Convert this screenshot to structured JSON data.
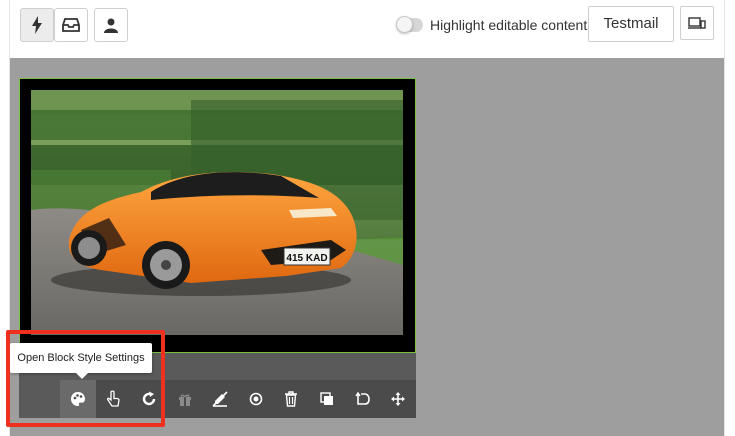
{
  "toolbar": {
    "buttons": [
      {
        "name": "lightning-icon",
        "active": true
      },
      {
        "name": "inbox-icon",
        "active": false
      },
      {
        "name": "user-icon",
        "active": false
      }
    ],
    "highlight_toggle_label": "Highlight editable content",
    "highlight_toggle_on": false,
    "testmail_label": "Testmail",
    "device_icon": "device-preview-icon"
  },
  "block": {
    "image_alt": "orange-sports-car-image",
    "license_plate": "415 KAD",
    "tooltip": "Open Block Style Settings",
    "actions": [
      {
        "name": "palette-icon",
        "active": true
      },
      {
        "name": "tap-hand-icon",
        "active": false
      },
      {
        "name": "refresh-icon",
        "active": false
      },
      {
        "name": "gift-icon",
        "active": false
      },
      {
        "name": "no-edit-icon",
        "active": false
      },
      {
        "name": "target-icon",
        "active": false
      },
      {
        "name": "trash-icon",
        "active": false
      },
      {
        "name": "duplicate-icon",
        "active": false
      },
      {
        "name": "undo-icon",
        "active": false
      },
      {
        "name": "move-icon",
        "active": false
      }
    ]
  },
  "colors": {
    "canvas_bg": "#9e9e9e",
    "block_bg": "#5a5a5a",
    "accent_border": "#7cc043",
    "highlight": "#f0301e"
  }
}
